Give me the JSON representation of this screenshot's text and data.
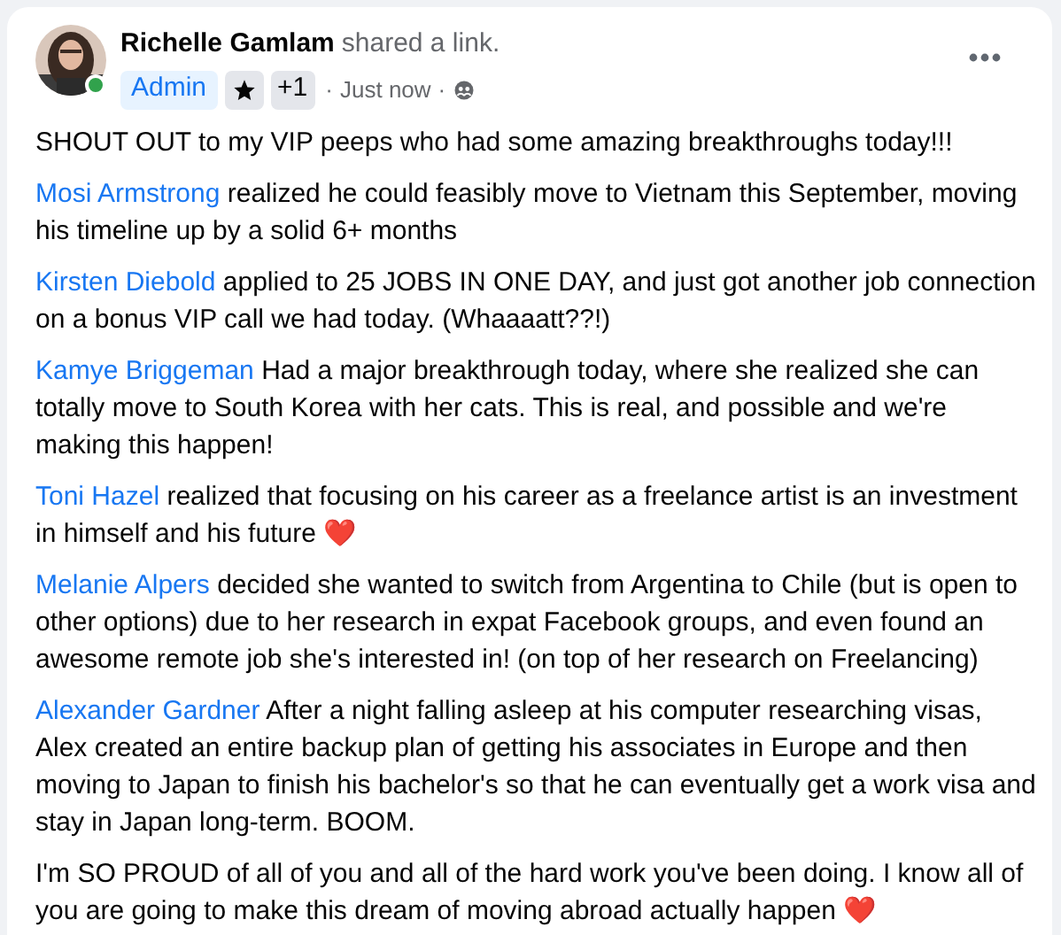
{
  "post": {
    "author": "Richelle Gamlam",
    "action": "shared a link.",
    "online": true,
    "badges": [
      {
        "kind": "role",
        "label": "Admin"
      },
      {
        "kind": "star"
      },
      {
        "kind": "count",
        "label": "+1"
      }
    ],
    "time": "Just now",
    "separator": "·",
    "paragraphs": [
      {
        "text": "SHOUT OUT to my VIP peeps who had some amazing breakthroughs today!!!"
      },
      {
        "name": "Mosi Armstrong",
        "text": "realized he could feasibly move to Vietnam this September, moving his timeline up by a solid 6+ months"
      },
      {
        "name": "Kirsten Diebold",
        "text": "applied to 25 JOBS IN ONE DAY, and just got another job connection on a bonus VIP call we had today. (Whaaaatt??!)"
      },
      {
        "name": "Kamye Briggeman",
        "text": "Had a major breakthrough today, where she realized she can totally move to South Korea with her cats. This is real, and possible and we're making this happen!"
      },
      {
        "name": "Toni Hazel",
        "text": "realized that focusing on his career as a freelance artist is an investment in himself and his future ❤️"
      },
      {
        "name": "Melanie Alpers",
        "text": "decided she wanted to switch from Argentina to Chile (but is open to other options) due to her research in expat Facebook groups, and even found an awesome remote job she's interested in! (on top of her research on Freelancing)"
      },
      {
        "name": "Alexander Gardner",
        "text": "After a night falling asleep at his computer researching visas, Alex created an entire backup plan of getting his associates in Europe and then moving to Japan to finish his bachelor's so that he can eventually get a work visa and stay in Japan long-term. BOOM."
      },
      {
        "text": "I'm SO PROUD of all of you and all of the hard work you've been doing. I know all of you are going to make this dream of moving abroad actually happen ❤️"
      }
    ]
  }
}
